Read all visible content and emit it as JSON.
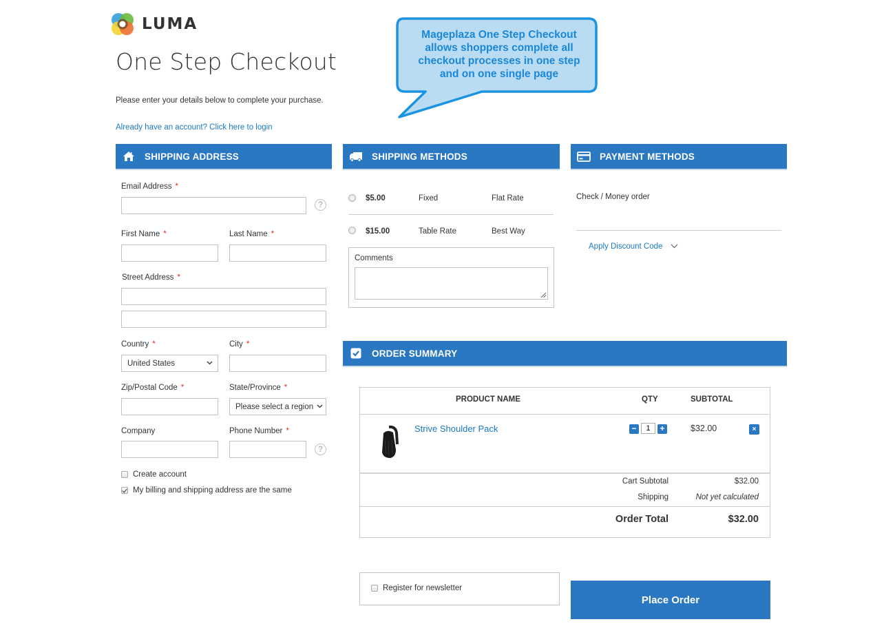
{
  "brand": {
    "name": "LUMA",
    "logo_icon": "luma-logo-icon"
  },
  "page": {
    "title": "One Step Checkout",
    "intro": "Please enter your details below to complete your purchase.",
    "login_link": "Already have an account? Click here to login"
  },
  "callout": {
    "lines": [
      "Mageplaza One Step Checkout",
      "allows shoppers complete all",
      "checkout processes in one step",
      "and on one single page"
    ]
  },
  "colors": {
    "accent": "#2b78c2",
    "link": "#1979c3",
    "required": "#e02b27",
    "callout_fill": "#b9dcf2",
    "callout_text": "#1a87d8"
  },
  "shipping_address": {
    "header": "Shipping Address",
    "icon": "home-icon",
    "fields": {
      "email": {
        "label": "Email Address",
        "required": "*",
        "value": ""
      },
      "first_name": {
        "label": "First Name",
        "required": "*",
        "value": ""
      },
      "last_name": {
        "label": "Last Name",
        "required": "*",
        "value": ""
      },
      "street": {
        "label": "Street Address",
        "required": "*",
        "line1": "",
        "line2": ""
      },
      "country": {
        "label": "Country",
        "required": "*",
        "value": "United States"
      },
      "city": {
        "label": "City",
        "required": "*",
        "value": ""
      },
      "zip": {
        "label": "Zip/Postal Code",
        "required": "*",
        "value": ""
      },
      "state": {
        "label": "State/Province",
        "required": "*",
        "value": "Please select a region"
      },
      "company": {
        "label": "Company",
        "value": ""
      },
      "phone": {
        "label": "Phone Number",
        "required": "*",
        "value": ""
      }
    },
    "help_glyph": "?",
    "create_account": {
      "label": "Create account",
      "checked": false
    },
    "billing_same": {
      "label": "My billing and shipping address are the same",
      "checked": true
    }
  },
  "shipping_methods": {
    "header": "Shipping Methods",
    "icon": "truck-icon",
    "options": [
      {
        "price": "$5.00",
        "method": "Fixed",
        "carrier": "Flat Rate",
        "selected": false
      },
      {
        "price": "$15.00",
        "method": "Table Rate",
        "carrier": "Best Way",
        "selected": false
      }
    ],
    "comments_label": "Comments",
    "comments_value": ""
  },
  "payment_methods": {
    "header": "Payment Methods",
    "icon": "credit-card-icon",
    "method": "Check / Money order",
    "discount_link": "Apply Discount Code"
  },
  "order_summary": {
    "header": "Order Summary",
    "icon": "checkbox-checked-icon",
    "columns": {
      "product": "Product Name",
      "qty": "Qty",
      "subtotal": "Subtotal"
    },
    "items": [
      {
        "name": "Strive Shoulder Pack",
        "qty": "1",
        "subtotal": "$32.00",
        "image": "backpack-image"
      }
    ],
    "qty_minus": "−",
    "qty_plus": "+",
    "remove_glyph": "×",
    "totals": {
      "cart_subtotal_label": "Cart Subtotal",
      "cart_subtotal_value": "$32.00",
      "shipping_label": "Shipping",
      "shipping_value": "Not yet calculated",
      "order_total_label": "Order Total",
      "order_total_value": "$32.00"
    }
  },
  "newsletter": {
    "label": "Register for newsletter",
    "checked": false
  },
  "place_order": {
    "label": "Place Order"
  }
}
